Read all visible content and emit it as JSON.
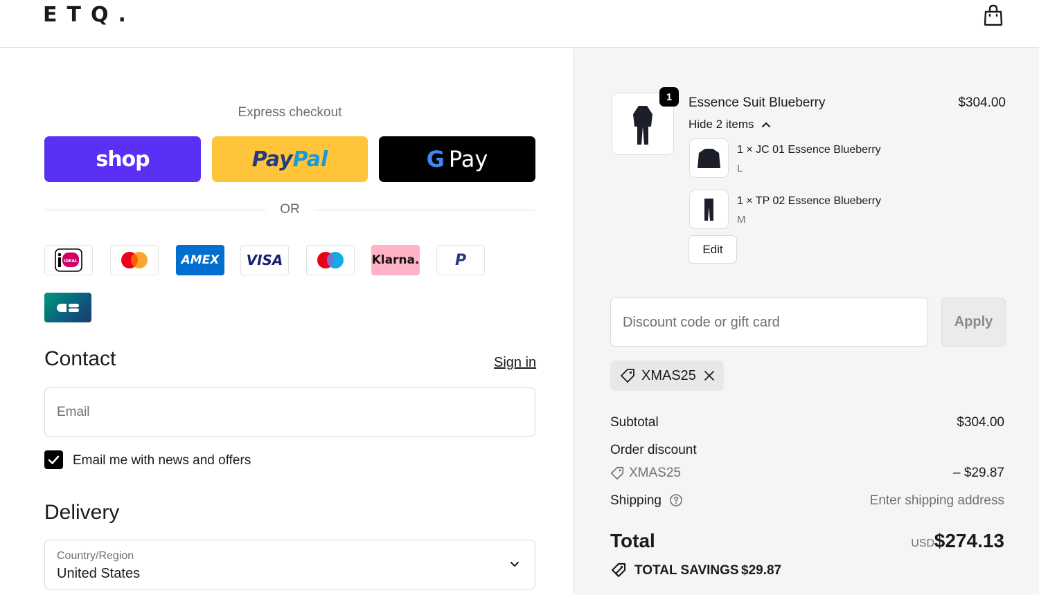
{
  "header": {
    "logo": "ETQ."
  },
  "express": {
    "title": "Express checkout",
    "shop_label": "shop",
    "paypal_part1": "Pay",
    "paypal_part2": "Pal",
    "gpay_g": "G",
    "gpay_label": "Pay",
    "or_label": "OR"
  },
  "payment_methods": [
    {
      "name": "ideal-icon",
      "label": "iDEAL"
    },
    {
      "name": "mastercard-icon",
      "label": ""
    },
    {
      "name": "amex-icon",
      "label": "AMEX"
    },
    {
      "name": "visa-icon",
      "label": "VISA"
    },
    {
      "name": "maestro-icon",
      "label": ""
    },
    {
      "name": "klarna-icon",
      "label": "Klarna."
    },
    {
      "name": "paypal-icon",
      "label": "P"
    },
    {
      "name": "cartes-bancaires-icon",
      "label": "CB"
    }
  ],
  "contact": {
    "title": "Contact",
    "sign_in": "Sign in",
    "email_placeholder": "Email",
    "newsletter_label": "Email me with news and offers",
    "newsletter_checked": true
  },
  "delivery": {
    "title": "Delivery",
    "country_label": "Country/Region",
    "country_value": "United States"
  },
  "order": {
    "quantity": "1",
    "product_name": "Essence Suit Blueberry",
    "product_price": "$304.00",
    "hide_items": "Hide 2 items",
    "items": [
      {
        "name": "1 × JC 01 Essence Blueberry",
        "size": "L"
      },
      {
        "name": "1 × TP 02 Essence Blueberry",
        "size": "M"
      }
    ],
    "edit_label": "Edit"
  },
  "discount": {
    "placeholder": "Discount code or gift card",
    "apply_label": "Apply",
    "applied_code": "XMAS25"
  },
  "summary": {
    "subtotal_label": "Subtotal",
    "subtotal_value": "$304.00",
    "order_discount_label": "Order discount",
    "discount_code": "XMAS25",
    "discount_value": "– $29.87",
    "shipping_label": "Shipping",
    "shipping_value": "Enter shipping address",
    "total_label": "Total",
    "total_currency": "USD",
    "total_value": "$274.13",
    "savings_label": "TOTAL SAVINGS",
    "savings_value": "$29.87"
  },
  "colors": {
    "shop_purple": "#5a31f4",
    "paypal_yellow": "#ffc439",
    "gpay_black": "#000000",
    "summary_bg": "#f5f5f5"
  }
}
